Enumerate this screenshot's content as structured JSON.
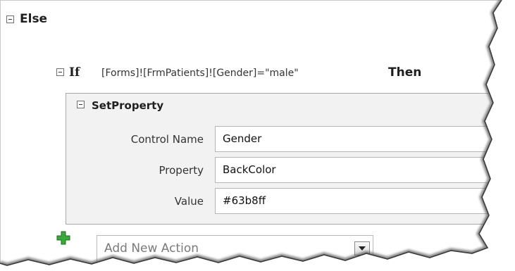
{
  "else_block": {
    "keyword": "Else"
  },
  "if_block": {
    "keyword": "If",
    "condition": "[Forms]![FrmPatients]![Gender]=\"male\"",
    "then_keyword": "Then"
  },
  "action": {
    "title": "SetProperty",
    "arguments": [
      {
        "label": "Control Name",
        "value": "Gender"
      },
      {
        "label": "Property",
        "value": "BackColor"
      },
      {
        "label": "Value",
        "value": "#63b8ff"
      }
    ]
  },
  "add_action": {
    "placeholder": "Add New Action"
  },
  "icons": {
    "collapse": "minus-box-icon",
    "add": "green-plus-icon",
    "dropdown": "chevron-down-icon"
  },
  "colors": {
    "add_icon": "#2e9e2e",
    "panel_bg": "#f2f2f2"
  }
}
